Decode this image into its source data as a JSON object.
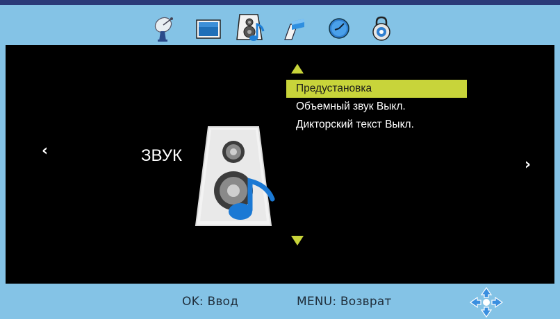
{
  "tabs": [
    {
      "name": "channel",
      "icon": "satellite-dish-icon",
      "active": false
    },
    {
      "name": "picture",
      "icon": "picture-screen-icon",
      "active": false
    },
    {
      "name": "sound",
      "icon": "speaker-icon",
      "active": true
    },
    {
      "name": "time",
      "icon": "time-icon",
      "active": false
    },
    {
      "name": "setup",
      "icon": "globe-icon",
      "active": false
    },
    {
      "name": "lock",
      "icon": "lock-icon",
      "active": false
    }
  ],
  "main": {
    "category_title": "ЗВУК",
    "category_icon": "speaker-music-icon",
    "nav_left": "‹",
    "nav_right": "›",
    "menu_items": [
      {
        "label": "Предустановка",
        "selected": true
      },
      {
        "label": "Объемный звук Выкл.",
        "selected": false
      },
      {
        "label": "Дикторский текст Выкл.",
        "selected": false
      }
    ]
  },
  "footer": {
    "ok_hint": "OK: Ввод",
    "menu_hint": "MENU: Возврат",
    "dpad_icon": "dpad-arrows-icon"
  },
  "colors": {
    "frame": "#84c3e6",
    "highlight": "#c8d43a",
    "scroll_arrow": "#c8d43a",
    "background": "#000000"
  }
}
